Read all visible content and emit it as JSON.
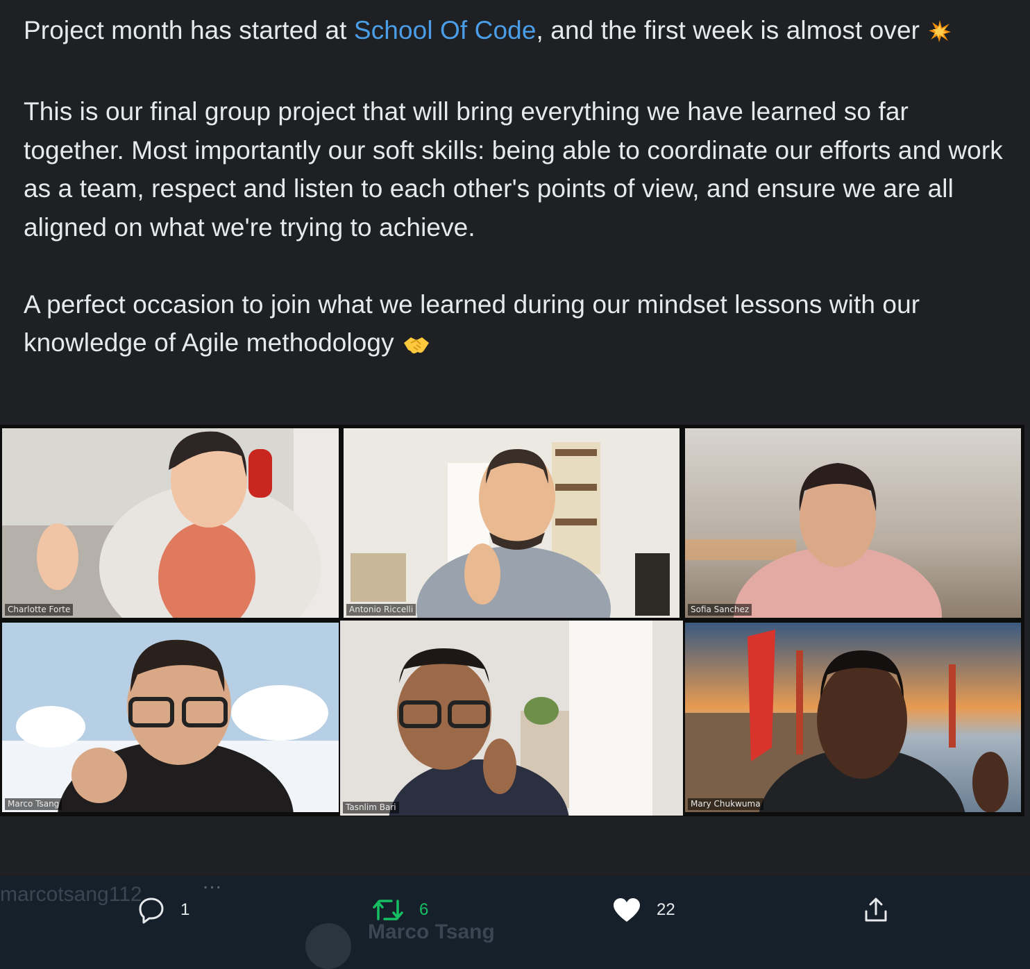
{
  "tweet": {
    "paragraphs": [
      {
        "before": "Project month has started at ",
        "mention": "School Of Code",
        "after": ", and the first week is almost over",
        "emoji": "collision-emoji"
      },
      {
        "text": "This is our final group project that will bring everything we have learned so far together. Most importantly our soft skills: being able to coordinate our efforts and work as a team, respect and listen to each other's points of view, and ensure we are all aligned on what we're trying to achieve."
      },
      {
        "text": "A perfect occasion to join what we learned during our mindset lessons with our knowledge of Agile methodology",
        "emoji": "handshake-emoji"
      }
    ],
    "colors": {
      "text": "#e7e9ea",
      "mention": "#4a9ee8",
      "retweet": "#17bf63",
      "background": "#1e2024"
    }
  },
  "video_call": {
    "participants": [
      {
        "name": "Charlotte Forte",
        "active": false
      },
      {
        "name": "Antonio Riccelli",
        "active": false
      },
      {
        "name": "Sofia Sanchez",
        "active": false
      },
      {
        "name": "Marco Tsang",
        "active": false
      },
      {
        "name": "Tasnlim Bari",
        "active": true
      },
      {
        "name": "Mary Chukwuma",
        "active": false
      }
    ]
  },
  "background_timeline": {
    "handle_fragment": "marcotsang112",
    "more": "...",
    "name_fragment": "Marco Tsang"
  },
  "actions": {
    "reply": {
      "icon": "reply-icon",
      "count": "1"
    },
    "retweet": {
      "icon": "retweet-icon",
      "count": "6"
    },
    "like": {
      "icon": "heart-icon",
      "count": "22"
    },
    "share": {
      "icon": "share-icon"
    }
  }
}
